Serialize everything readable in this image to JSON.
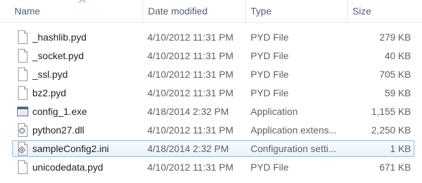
{
  "columns": {
    "name": "Name",
    "date_modified": "Date modified",
    "type": "Type",
    "size": "Size"
  },
  "sort": {
    "column": "name",
    "direction": "ascending"
  },
  "files": [
    {
      "name": "_hashlib.pyd",
      "date": "4/10/2012 11:31 PM",
      "type": "PYD File",
      "size": "279 KB",
      "icon": "blank-file-icon"
    },
    {
      "name": "_socket.pyd",
      "date": "4/10/2012 11:31 PM",
      "type": "PYD File",
      "size": "40 KB",
      "icon": "blank-file-icon"
    },
    {
      "name": "_ssl.pyd",
      "date": "4/10/2012 11:31 PM",
      "type": "PYD File",
      "size": "705 KB",
      "icon": "blank-file-icon"
    },
    {
      "name": "bz2.pyd",
      "date": "4/10/2012 11:31 PM",
      "type": "PYD File",
      "size": "59 KB",
      "icon": "blank-file-icon"
    },
    {
      "name": "config_1.exe",
      "date": "4/18/2014 2:32 PM",
      "type": "Application",
      "size": "1,155 KB",
      "icon": "application-window-icon"
    },
    {
      "name": "python27.dll",
      "date": "4/10/2012 11:31 PM",
      "type": "Application extens...",
      "size": "2,250 KB",
      "icon": "dll-gear-file-icon"
    },
    {
      "name": "sampleConfig2.ini",
      "date": "4/18/2014 2:32 PM",
      "type": "Configuration setti...",
      "size": "1 KB",
      "icon": "settings-file-icon",
      "selected": true
    },
    {
      "name": "unicodedata.pyd",
      "date": "4/10/2012 11:31 PM",
      "type": "PYD File",
      "size": "671 KB",
      "icon": "blank-file-icon"
    }
  ],
  "colors": {
    "header_text": "#4c607a",
    "selection_border": "#8fb5d8",
    "selection_fill": "#eaf3fc"
  }
}
